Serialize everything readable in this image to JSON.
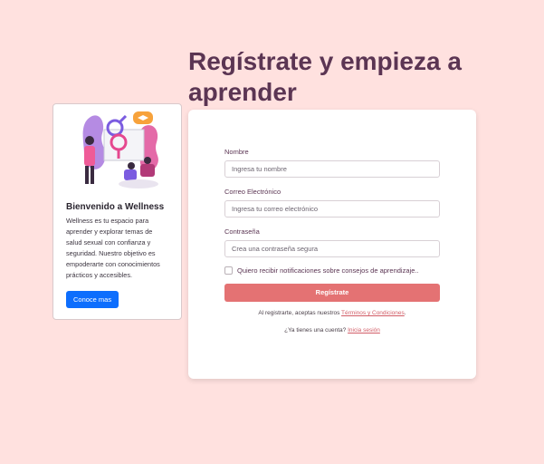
{
  "header": {
    "title": "Regístrate y empieza a aprender"
  },
  "info_card": {
    "title": "Bienvenido a Wellness",
    "text": "Wellness es tu espacio para aprender y explorar temas de salud sexual con confianza y seguridad. Nuestro objetivo es empoderarte con conocimientos prácticos y accesibles.",
    "button_label": "Conoce mas",
    "illustration_icon": "people-gender-symbols-graduation-illustration"
  },
  "form": {
    "fields": [
      {
        "label": "Nombre",
        "placeholder": "Ingresa tu nombre"
      },
      {
        "label": "Correo Electrónico",
        "placeholder": "Ingresa tu correo electrónico"
      },
      {
        "label": "Contraseña",
        "placeholder": "Crea una contraseña segura"
      }
    ],
    "notifications_label": "Quiero recibir notificaciones sobre consejos de aprendizaje..",
    "submit_label": "Regístrate",
    "terms_prefix": "Al registrarte, aceptas nuestros ",
    "terms_link": "Términos y Condiciones",
    "terms_suffix": ".",
    "login_prefix": "¿Ya tienes una cuenta? ",
    "login_link": "Inicia sesión"
  },
  "colors": {
    "background": "#ffe1df",
    "accent": "#e47273",
    "primary_button": "#0d6efd",
    "title": "#5b3553"
  }
}
